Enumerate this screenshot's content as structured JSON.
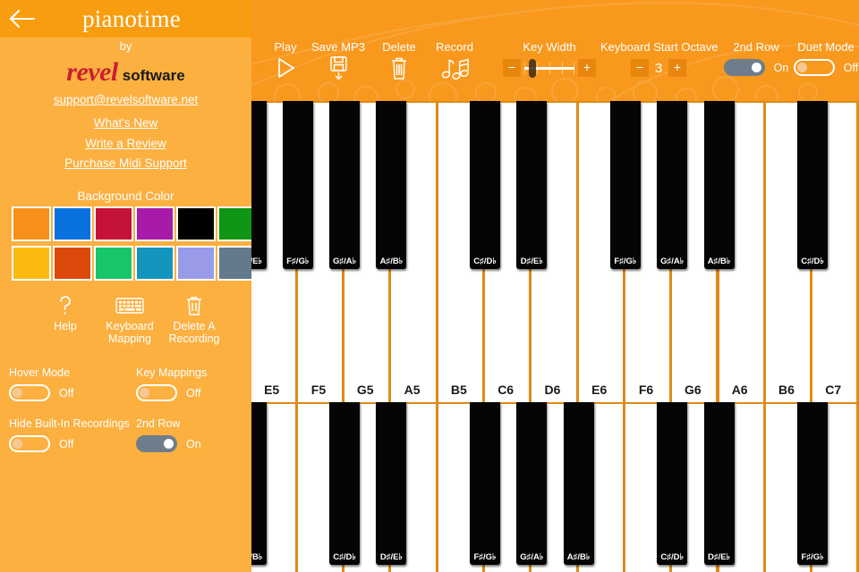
{
  "sidebar": {
    "back_icon": "back-arrow-icon",
    "app_title": "pianotime",
    "by_label": "by",
    "brand_name": "revel",
    "brand_suffix": "software",
    "links": [
      {
        "id": "email",
        "label": "support@revelsoftware.net"
      },
      {
        "id": "whatsnew",
        "label": "What's New"
      },
      {
        "id": "review",
        "label": "Write a Review"
      },
      {
        "id": "midi",
        "label": "Purchase Midi Support"
      }
    ],
    "background_color_label": "Background Color",
    "swatches": [
      {
        "name": "orange",
        "hex": "#F79018"
      },
      {
        "name": "blue",
        "hex": "#0A72DE"
      },
      {
        "name": "crimson",
        "hex": "#C41239"
      },
      {
        "name": "magenta",
        "hex": "#A71BA8"
      },
      {
        "name": "black",
        "hex": "#000000"
      },
      {
        "name": "green",
        "hex": "#0E9614"
      },
      {
        "name": "amber",
        "hex": "#FBBA10"
      },
      {
        "name": "dark-orange",
        "hex": "#DC4A0B"
      },
      {
        "name": "emerald",
        "hex": "#18C569"
      },
      {
        "name": "teal",
        "hex": "#1395BE"
      },
      {
        "name": "periwinkle",
        "hex": "#9A9BE8"
      },
      {
        "name": "slate",
        "hex": "#63798C"
      }
    ],
    "icon_buttons": [
      {
        "id": "help",
        "icon": "question-mark-icon",
        "label": "Help"
      },
      {
        "id": "keymap",
        "icon": "keyboard-icon",
        "label": "Keyboard\nMapping"
      },
      {
        "id": "delrec",
        "icon": "trash-icon",
        "label": "Delete A\nRecording"
      }
    ],
    "toggles": [
      {
        "id": "hover",
        "label": "Hover Mode",
        "state": "Off",
        "on": false
      },
      {
        "id": "keymaps",
        "label": "Key Mappings",
        "state": "Off",
        "on": false
      },
      {
        "id": "hiderec",
        "label": "Hide Built-In Recordings",
        "state": "Off",
        "on": false
      },
      {
        "id": "row2",
        "label": "2nd Row",
        "state": "On",
        "on": true
      }
    ]
  },
  "toolbar": {
    "buttons": [
      {
        "id": "play",
        "label": "Play",
        "icon": "play-triangle-icon"
      },
      {
        "id": "mp3",
        "label": "Save MP3",
        "icon": "floppy-save-icon"
      },
      {
        "id": "delete",
        "label": "Delete",
        "icon": "trash-icon"
      },
      {
        "id": "record",
        "label": "Record",
        "icon": "music-notes-icon"
      }
    ],
    "key_width": {
      "label": "Key Width",
      "minus": "−",
      "plus": "+",
      "slider_percent": 16
    },
    "start_octave": {
      "label": "Keyboard Start Octave",
      "minus": "−",
      "plus": "+",
      "value": "3"
    },
    "second_row": {
      "label": "2nd Row",
      "state": "On",
      "on": true
    },
    "duet_mode": {
      "label": "Duet Mode",
      "state": "Off",
      "on": false
    },
    "cut_off": {
      "label": "ode",
      "state": "Off",
      "on": false
    }
  },
  "keyboard": {
    "top_row": {
      "white_keys": [
        "E5",
        "F5",
        "G5",
        "A5",
        "B5",
        "C6",
        "D6",
        "E6",
        "F6",
        "G6",
        "A6",
        "B6",
        "C7"
      ],
      "black_keys": [
        {
          "label": "D♯/E♭",
          "after": 0,
          "partial": true
        },
        {
          "label": "F♯/G♭",
          "after": 1,
          "partial": false
        },
        {
          "label": "G♯/A♭",
          "after": 2,
          "partial": false
        },
        {
          "label": "A♯/B♭",
          "after": 3,
          "partial": false
        },
        {
          "label": "C♯/D♭",
          "after": 5,
          "partial": false
        },
        {
          "label": "D♯/E♭",
          "after": 6,
          "partial": false
        },
        {
          "label": "F♯/G♭",
          "after": 8,
          "partial": false
        },
        {
          "label": "G♯/A♭",
          "after": 9,
          "partial": false
        },
        {
          "label": "A♯/B♭",
          "after": 10,
          "partial": false
        },
        {
          "label": "C♯/D♭",
          "after": 12,
          "partial": false
        }
      ]
    },
    "bottom_row": {
      "white_count": 13,
      "black_keys": [
        {
          "label": "A♯/B♭",
          "after": 0
        },
        {
          "label": "C♯/D♭",
          "after": 2
        },
        {
          "label": "D♯/E♭",
          "after": 3
        },
        {
          "label": "F♯/G♭",
          "after": 5
        },
        {
          "label": "G♯/A♭",
          "after": 6
        },
        {
          "label": "A♯/B♭",
          "after": 7
        },
        {
          "label": "C♯/D♭",
          "after": 9
        },
        {
          "label": "D♯/E♭",
          "after": 10
        },
        {
          "label": "F♯/G♭",
          "after": 12
        }
      ]
    }
  },
  "colors": {
    "header_orange": "#F99D10",
    "sidebar_orange": "#FBB040",
    "toolbar_orange": "#F8981D",
    "key_divider": "#DD8A15",
    "brand_red": "#C9202F",
    "toggle_on": "#6E7D8C"
  }
}
